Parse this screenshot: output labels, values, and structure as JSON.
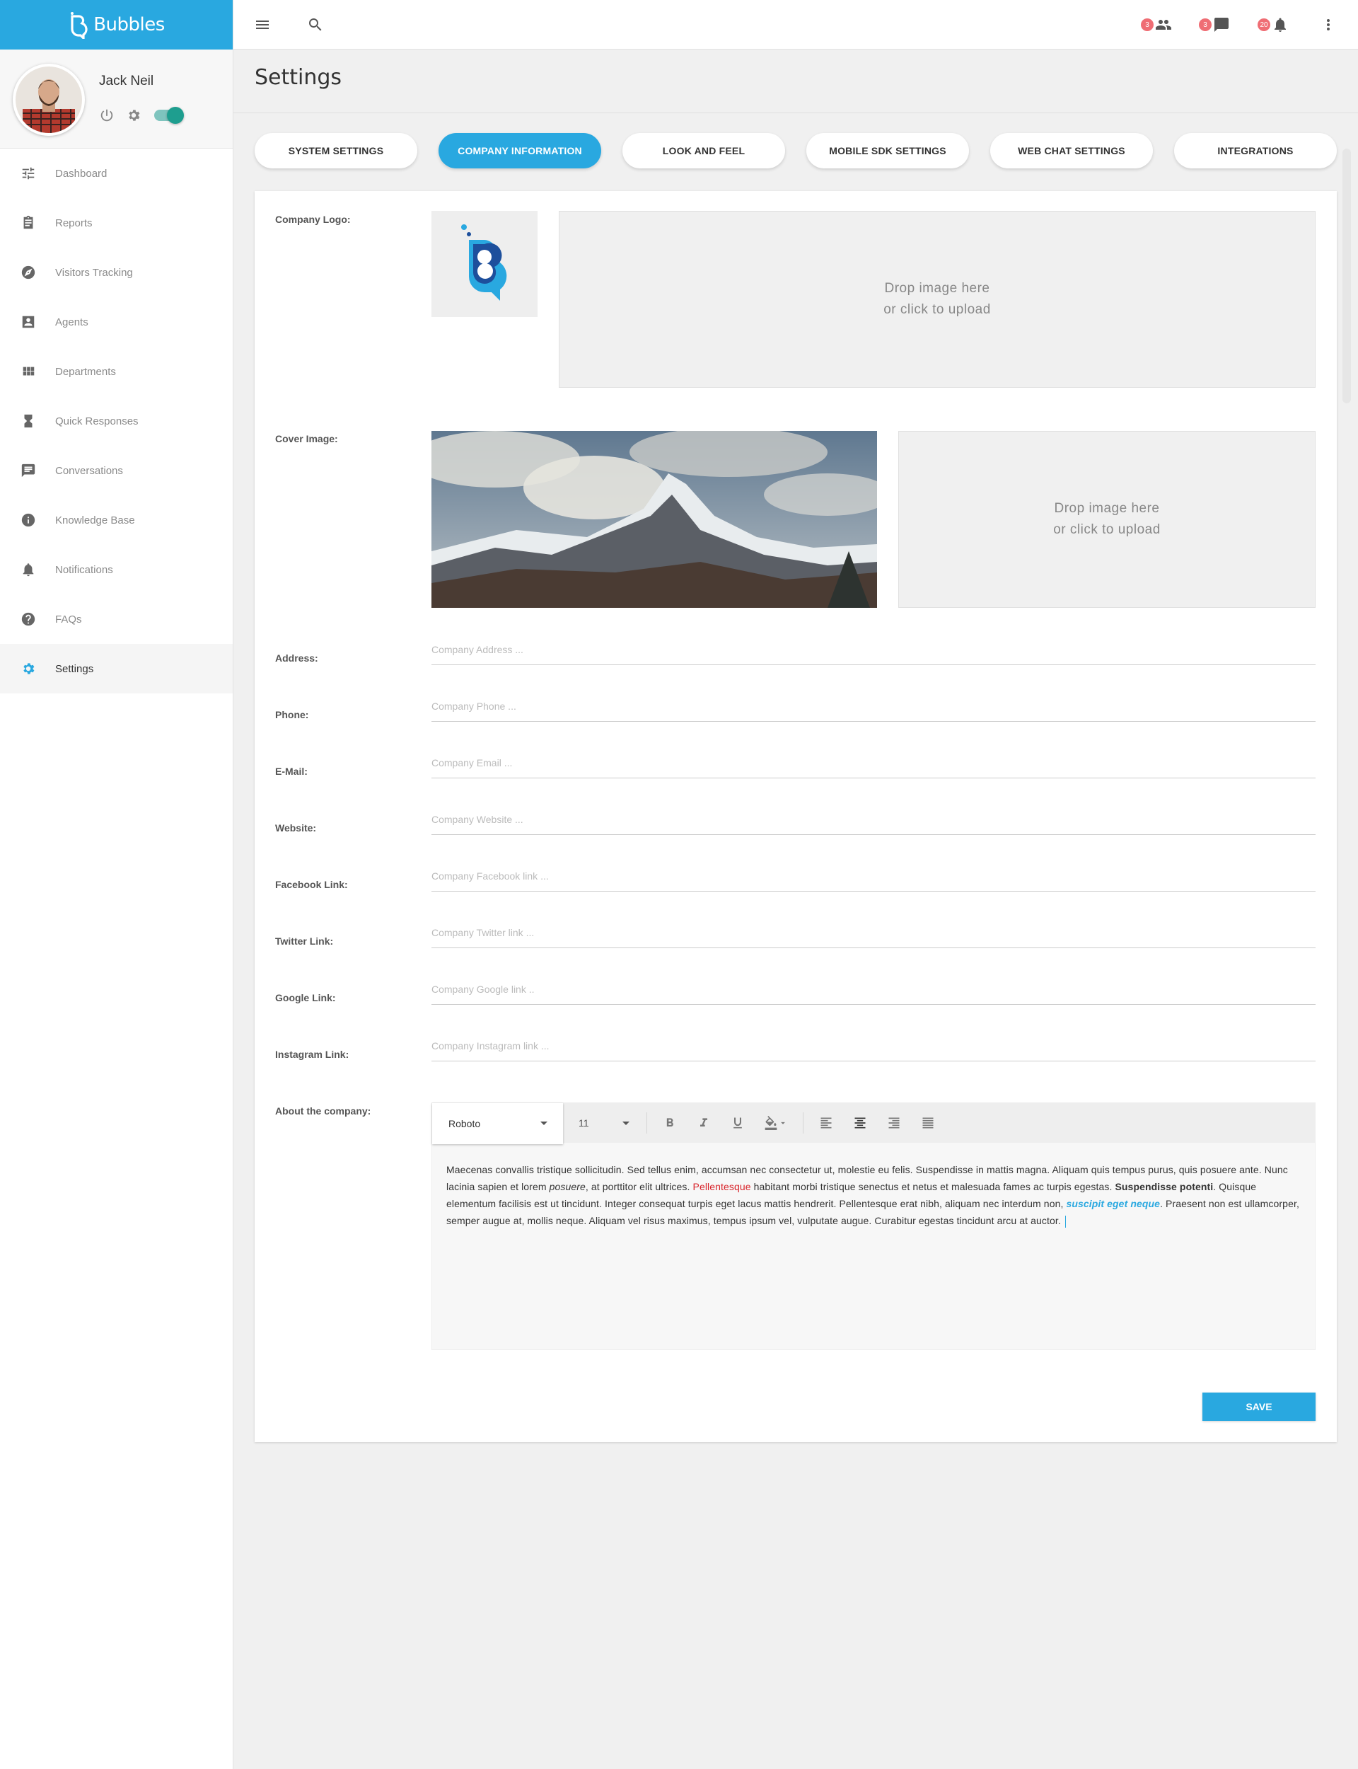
{
  "app": {
    "name": "Bubbles",
    "accent_color": "#29a8e0"
  },
  "user": {
    "name": "Jack Neil",
    "status_toggle": "on"
  },
  "sidebar": {
    "items": [
      {
        "label": "Dashboard",
        "icon": "sliders-icon"
      },
      {
        "label": "Reports",
        "icon": "clipboard-icon"
      },
      {
        "label": "Visitors Tracking",
        "icon": "compass-icon"
      },
      {
        "label": "Agents",
        "icon": "contact-card-icon"
      },
      {
        "label": "Departments",
        "icon": "grid-icon"
      },
      {
        "label": "Quick Responses",
        "icon": "hourglass-icon"
      },
      {
        "label": "Conversations",
        "icon": "chat-icon"
      },
      {
        "label": "Knowledge Base",
        "icon": "info-icon"
      },
      {
        "label": "Notifications",
        "icon": "bell-icon"
      },
      {
        "label": "FAQs",
        "icon": "help-icon"
      },
      {
        "label": "Settings",
        "icon": "gear-icon",
        "active": true
      }
    ]
  },
  "topbar": {
    "people_badge": "3",
    "chat_badge": "3",
    "bell_badge": "20"
  },
  "page": {
    "title": "Settings"
  },
  "tabs": [
    {
      "label": "System Settings"
    },
    {
      "label": "Company Information",
      "active": true
    },
    {
      "label": "Look and Feel"
    },
    {
      "label": "Mobile SDK Settings"
    },
    {
      "label": "Web Chat Settings"
    },
    {
      "label": "Integrations"
    }
  ],
  "form": {
    "logo_label": "Company Logo:",
    "cover_label": "Cover Image:",
    "dropzone_line1": "Drop image here",
    "dropzone_line2": "or click to upload",
    "fields": [
      {
        "label": "Address:",
        "placeholder": "Company Address ..."
      },
      {
        "label": "Phone:",
        "placeholder": "Company Phone ..."
      },
      {
        "label": "E-Mail:",
        "placeholder": "Company Email ..."
      },
      {
        "label": "Website:",
        "placeholder": "Company Website ..."
      },
      {
        "label": "Facebook Link:",
        "placeholder": "Company Facebook link ..."
      },
      {
        "label": "Twitter Link:",
        "placeholder": "Company Twitter link ..."
      },
      {
        "label": "Google Link:",
        "placeholder": "Company Google link .."
      },
      {
        "label": "Instagram Link:",
        "placeholder": "Company Instagram link ..."
      }
    ],
    "about_label": "About the company:",
    "editor": {
      "font": "Roboto",
      "size": "11",
      "text_1": "Maecenas convallis tristique sollicitudin. Sed tellus enim, accumsan nec consectetur ut, molestie eu felis. Suspendisse in mattis magna. Aliquam quis tempus purus, quis posuere ante. Nunc lacinia sapien et lorem ",
      "text_italic": "posuere",
      "text_2": ", at porttitor elit ultrices. ",
      "text_red": "Pellentesque",
      "text_3": " habitant morbi tristique senectus et netus et malesuada fames ac turpis egestas. ",
      "text_bold": "Suspendisse potenti",
      "text_4": ". Quisque elementum facilisis est ut tincidunt. Integer consequat turpis eget lacus mattis hendrerit. Pellentesque erat nibh, aliquam nec interdum non, ",
      "text_blue": "suscipit eget neque",
      "text_5": ". Praesent non est ullamcorper, semper augue at, mollis neque. Aliquam vel risus maximus, tempus ipsum vel, vulputate augue. Curabitur egestas tincidunt arcu at auctor."
    },
    "save_label": "Save"
  }
}
